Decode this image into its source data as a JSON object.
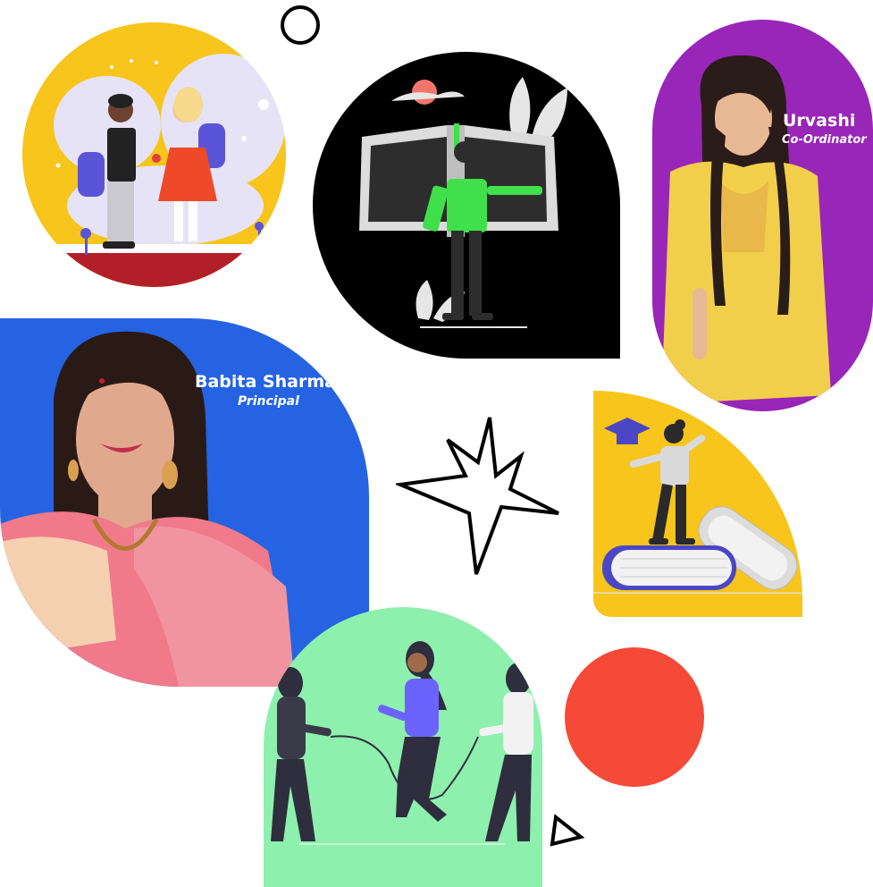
{
  "people": [
    {
      "name": "Urvashi",
      "role": "Co-Ordinator"
    },
    {
      "name": "Babita Sharma",
      "role": "Principal"
    }
  ],
  "colors": {
    "yellow": "#f7c51b",
    "purple": "#9826b8",
    "blue": "#2563e2",
    "green": "#8ef0ad",
    "red": "#f44a37",
    "black": "#000000"
  }
}
